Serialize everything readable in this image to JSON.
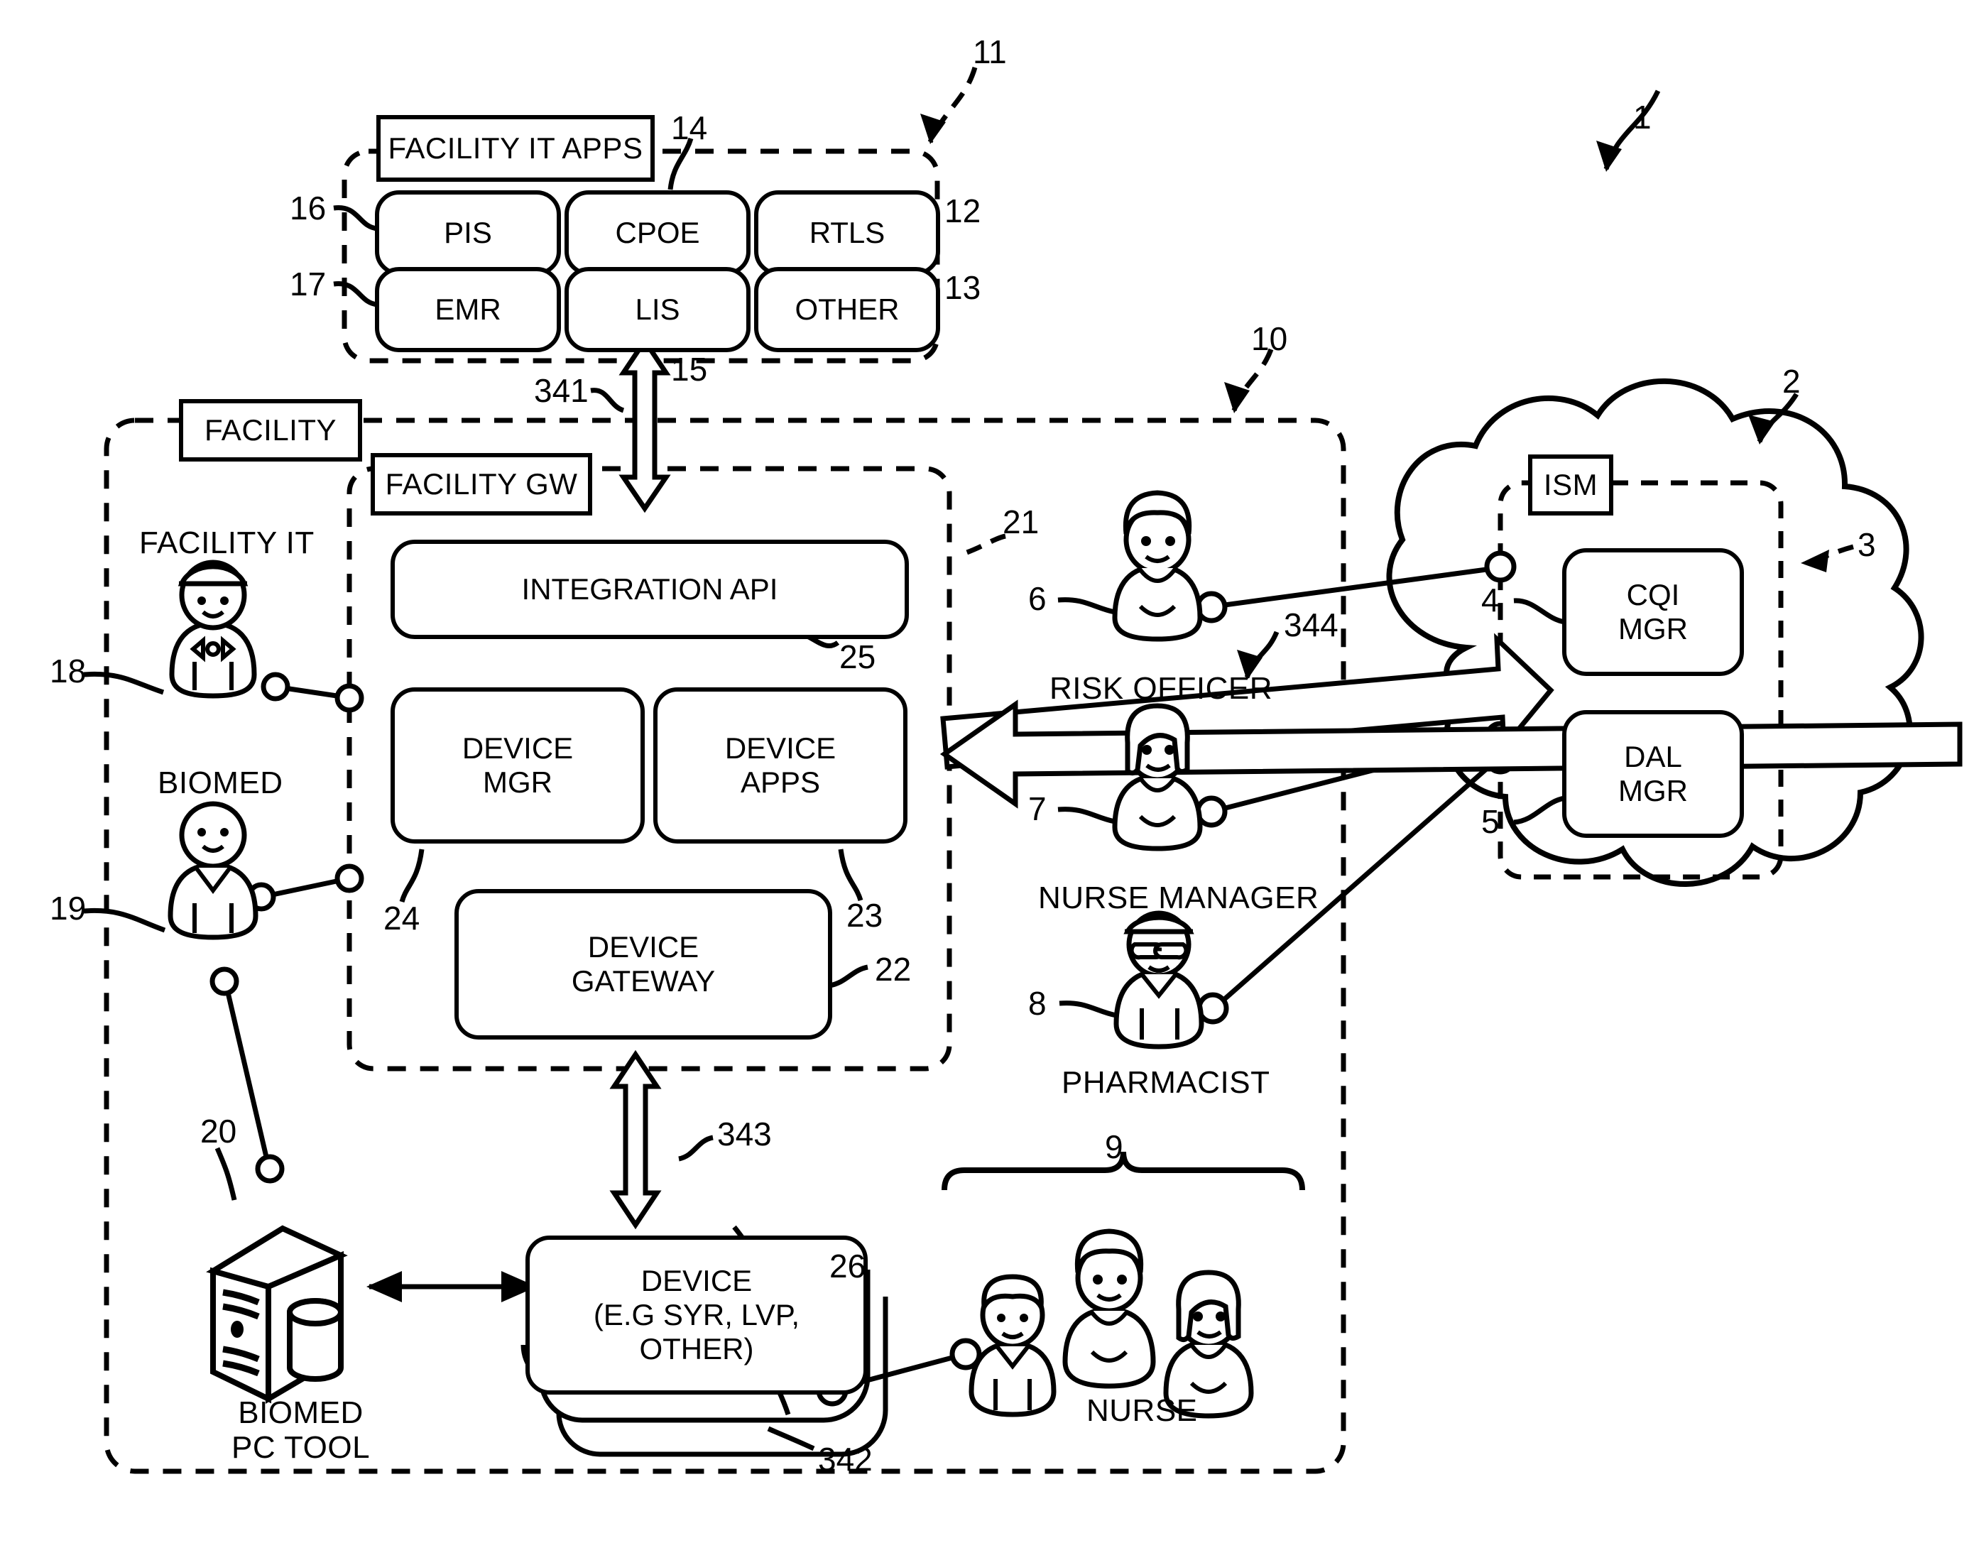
{
  "figure": {
    "type": "patent-system-diagram",
    "refs": {
      "r1": "1",
      "r2": "2",
      "r3": "3",
      "r4": "4",
      "r5": "5",
      "r6": "6",
      "r7": "7",
      "r8": "8",
      "r9": "9",
      "r10": "10",
      "r11": "11",
      "r12": "12",
      "r13": "13",
      "r14": "14",
      "r15": "15",
      "r16": "16",
      "r17": "17",
      "r18": "18",
      "r19": "19",
      "r20": "20",
      "r21": "21",
      "r22": "22",
      "r23": "23",
      "r24": "24",
      "r25": "25",
      "r26": "26",
      "r341": "341",
      "r342": "342",
      "r343": "343",
      "r344": "344"
    }
  },
  "facility_it_apps": {
    "title": "FACILITY IT APPS",
    "apps": [
      {
        "label": "PIS"
      },
      {
        "label": "CPOE"
      },
      {
        "label": "RTLS"
      },
      {
        "label": "EMR"
      },
      {
        "label": "LIS"
      },
      {
        "label": "OTHER"
      }
    ]
  },
  "facility": {
    "title": "FACILITY",
    "gateway": {
      "title": "FACILITY GW",
      "blocks": [
        {
          "label": "INTEGRATION API"
        },
        {
          "label": "DEVICE\nMGR"
        },
        {
          "label": "DEVICE\nAPPS"
        },
        {
          "label": "DEVICE\nGATEWAY"
        }
      ]
    },
    "actors": [
      {
        "label": "FACILITY IT"
      },
      {
        "label": "BIOMED"
      }
    ],
    "biomed_pc_tool": {
      "label": "BIOMED\nPC TOOL"
    },
    "device": {
      "label": "DEVICE\n(E.G SYR, LVP,\nOTHER)"
    },
    "staff": [
      {
        "label": "RISK OFFICER"
      },
      {
        "label": "NURSE MANAGER"
      },
      {
        "label": "PHARMACIST"
      },
      {
        "label": "NURSE"
      }
    ]
  },
  "cloud": {
    "ism_title": "ISM",
    "managers": [
      {
        "label": "CQI\nMGR"
      },
      {
        "label": "DAL\nMGR"
      }
    ]
  },
  "colors": {
    "ink": "#000000",
    "paper": "#ffffff"
  }
}
